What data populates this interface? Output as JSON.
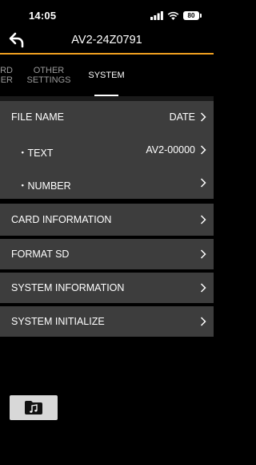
{
  "status": {
    "time": "14:05",
    "battery": "80"
  },
  "header": {
    "title": "AV2-24Z0791"
  },
  "tabs": [
    {
      "label": "RD\nER"
    },
    {
      "label": "OTHER\nSETTINGS"
    },
    {
      "label": "SYSTEM"
    }
  ],
  "file_group": {
    "file_name": {
      "label": "FILE NAME",
      "value": "DATE"
    },
    "text": {
      "label": "・TEXT",
      "value": "AV2-00000"
    },
    "number": {
      "label": "・NUMBER"
    }
  },
  "menu": {
    "card_information": "CARD INFORMATION",
    "format_sd": "FORMAT SD",
    "system_information": "SYSTEM INFORMATION",
    "system_initialize": "SYSTEM INITIALIZE"
  },
  "colors": {
    "accent": "#f0a020",
    "row_bg": "#3d3d3d",
    "background": "#000000"
  }
}
